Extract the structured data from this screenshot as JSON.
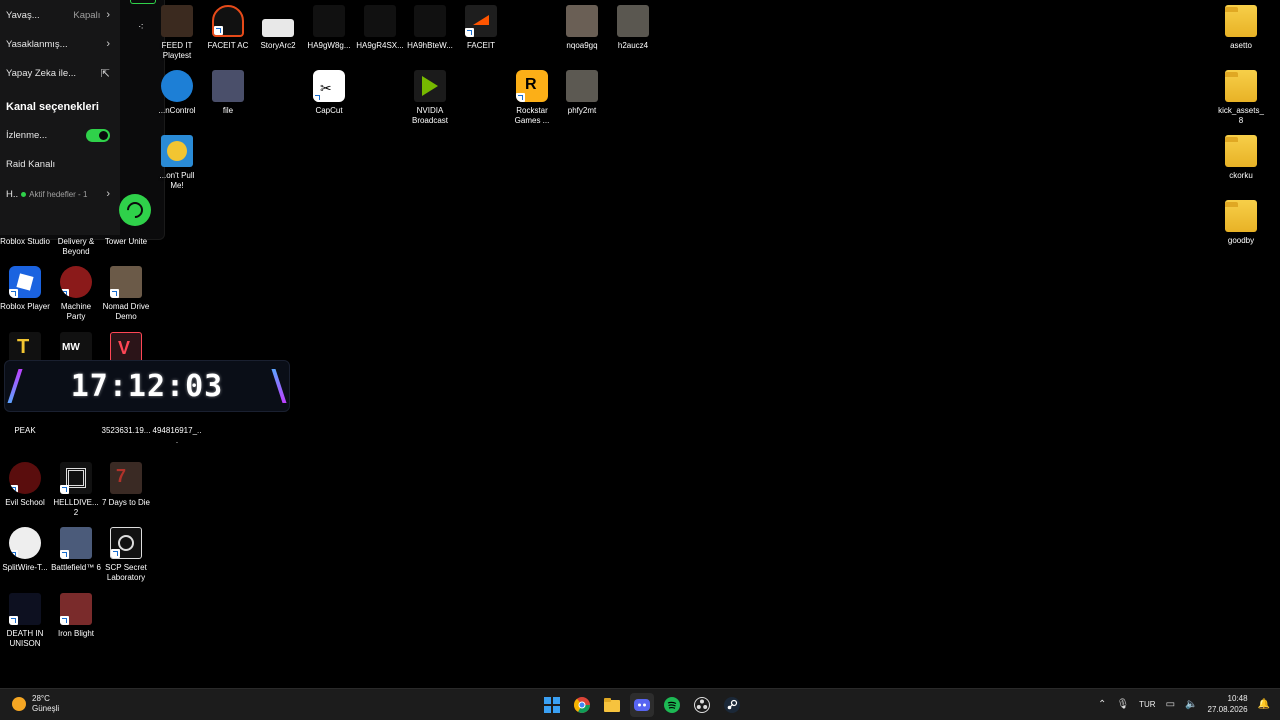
{
  "panel": {
    "rows": [
      {
        "label": "Yavaş...",
        "value": "Kapalı"
      },
      {
        "label": "Yasaklanmış...",
        "value": ""
      },
      {
        "label": "Yapay Zeka ile...",
        "value": ""
      }
    ],
    "section_title": "Kanal seçenekleri",
    "watch_label": "İzlenme...",
    "raid_label": "Raid Kanalı",
    "goal_label": "H..",
    "goal_status": "Aktif hedefler - 1"
  },
  "clock": {
    "time": "17:12:03"
  },
  "desktop_icons": [
    {
      "label": "FEED IT Playtest"
    },
    {
      "label": "FACEIT AC"
    },
    {
      "label": "StoryArc2"
    },
    {
      "label": "HA9gW8g..."
    },
    {
      "label": "HA9gR4SX..."
    },
    {
      "label": "HA9hBteW..."
    },
    {
      "label": "FACEIT"
    },
    {
      "label": "nqoa9gq"
    },
    {
      "label": "h2aucz4"
    },
    {
      "label": "asetto"
    },
    {
      "label": "...nControl"
    },
    {
      "label": "file"
    },
    {
      "label": "CapCut"
    },
    {
      "label": "NVIDIA Broadcast"
    },
    {
      "label": "Rockstar Games ..."
    },
    {
      "label": "phfy2mt"
    },
    {
      "label": "kick_assets_8"
    },
    {
      "label": "...on't Pull Me!"
    },
    {
      "label": "ckorku"
    },
    {
      "label": "goodby"
    },
    {
      "label": "Roblox Studio"
    },
    {
      "label": "Delivery & Beyond"
    },
    {
      "label": "Tower Unite"
    },
    {
      "label": "Roblox Player"
    },
    {
      "label": "Machine Party"
    },
    {
      "label": "Nomad Drive Demo"
    },
    {
      "label": "PEAK"
    },
    {
      "label": "3523631.19..."
    },
    {
      "label": "494816917_..."
    },
    {
      "label": "Evil School"
    },
    {
      "label": "HELLDIVE... 2"
    },
    {
      "label": "7 Days to Die"
    },
    {
      "label": "SplitWire-T..."
    },
    {
      "label": "Battlefield™ 6"
    },
    {
      "label": "SCP Secret Laboratory"
    },
    {
      "label": "DEATH IN UNISON"
    },
    {
      "label": "Iron Blight"
    }
  ],
  "taskbar": {
    "weather_temp": "28°C",
    "weather_desc": "Güneşli",
    "language": "TUR",
    "time": "10:48",
    "date": "27.08.2026",
    "apps": [
      "windows-start",
      "chrome",
      "file-explorer",
      "discord",
      "spotify",
      "obs",
      "steam"
    ]
  },
  "colors": {
    "accent_green": "#2fd14a",
    "desktop_bg": "#000000",
    "taskbar_bg": "#1c1c1c"
  }
}
